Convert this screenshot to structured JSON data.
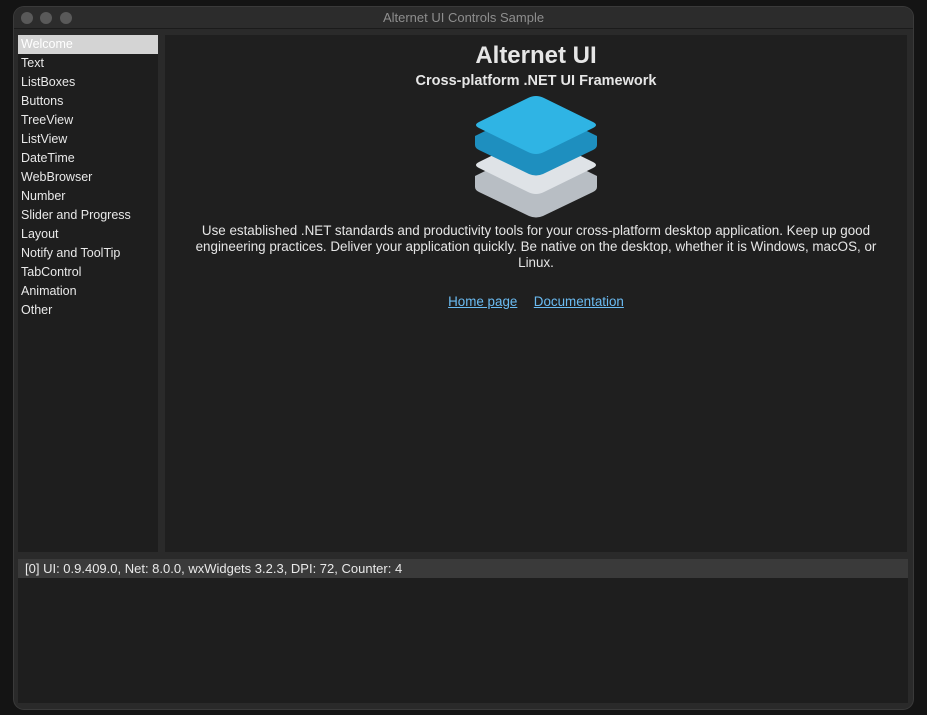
{
  "window": {
    "title": "Alternet UI Controls Sample"
  },
  "sidebar": {
    "items": [
      {
        "label": "Welcome",
        "selected": true
      },
      {
        "label": "Text"
      },
      {
        "label": "ListBoxes"
      },
      {
        "label": "Buttons"
      },
      {
        "label": "TreeView"
      },
      {
        "label": "ListView"
      },
      {
        "label": "DateTime"
      },
      {
        "label": "WebBrowser"
      },
      {
        "label": "Number"
      },
      {
        "label": "Slider and Progress"
      },
      {
        "label": "Layout"
      },
      {
        "label": "Notify and ToolTip"
      },
      {
        "label": "TabControl"
      },
      {
        "label": "Animation"
      },
      {
        "label": "Other"
      }
    ]
  },
  "main": {
    "title": "Alternet UI",
    "subtitle": "Cross-platform .NET UI Framework",
    "logo_icon": "layered-stack-logo-icon",
    "description": "Use established .NET standards and productivity tools for your cross-platform desktop application. Keep up good engineering practices. Deliver your application quickly. Be native on the desktop, whether it is Windows, macOS, or Linux.",
    "links": {
      "home": "Home page",
      "docs": "Documentation"
    }
  },
  "log": {
    "lines": [
      "[0] UI: 0.9.409.0, Net: 8.0.0, wxWidgets 3.2.3, DPI: 72, Counter: 4"
    ]
  },
  "colors": {
    "background": "#1f1f1f",
    "selection": "#d4d4d4",
    "link": "#6bbcf3",
    "logo_blue": "#2fb4e4",
    "logo_gray": "#dfe3e7"
  }
}
